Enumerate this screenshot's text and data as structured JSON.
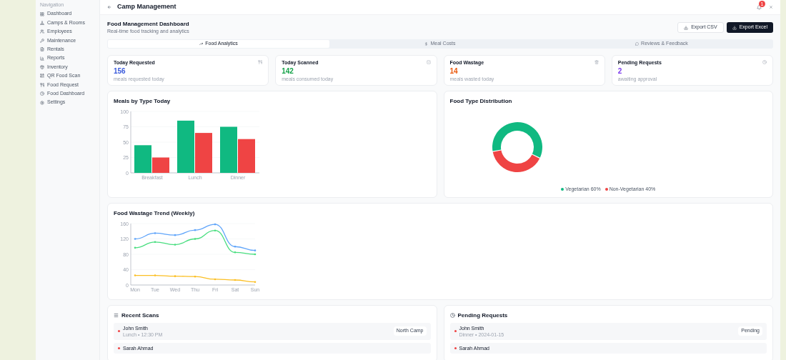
{
  "header": {
    "title": "Camp Management",
    "notification_count": "1"
  },
  "sidebar": {
    "heading": "Navigation",
    "items": [
      {
        "label": "Dashboard"
      },
      {
        "label": "Camps & Rooms"
      },
      {
        "label": "Employees"
      },
      {
        "label": "Maintenance"
      },
      {
        "label": "Rentals"
      },
      {
        "label": "Reports"
      },
      {
        "label": "Inventory"
      },
      {
        "label": "QR Food Scan"
      },
      {
        "label": "Food Request"
      },
      {
        "label": "Food Dashboard"
      },
      {
        "label": "Settings"
      }
    ]
  },
  "page": {
    "title": "Food Management Dashboard",
    "subtitle": "Real-time food tracking and analytics",
    "buttons": [
      {
        "label": "Export CSV",
        "kind": "outline"
      },
      {
        "label": "Export Excel",
        "kind": "solid"
      }
    ]
  },
  "tabs": [
    {
      "label": "Food Analytics",
      "selected": true
    },
    {
      "label": "Meal Costs",
      "selected": false
    },
    {
      "label": "Reviews & Feedback",
      "selected": false
    }
  ],
  "stats": [
    {
      "title": "Today Requested",
      "value": "156",
      "note": "meals requested today",
      "color": "#3b5bdb"
    },
    {
      "title": "Today Scanned",
      "value": "142",
      "note": "meals consumed today",
      "color": "#16a34a"
    },
    {
      "title": "Food Wastage",
      "value": "14",
      "note": "meals wasted today",
      "color": "#ea580c"
    },
    {
      "title": "Pending Requests",
      "value": "2",
      "note": "awaiting approval",
      "color": "#7c3aed"
    }
  ],
  "meals_chart": {
    "title": "Meals by Type Today",
    "chart_data": {
      "type": "bar",
      "categories": [
        "Breakfast",
        "Lunch",
        "Dinner"
      ],
      "ylim": [
        0,
        100
      ],
      "yticks": [
        0,
        25,
        50,
        75,
        100
      ],
      "series": [
        {
          "color": "#10b981",
          "values": [
            45,
            85,
            75
          ]
        },
        {
          "color": "#ef4444",
          "values": [
            25,
            65,
            55
          ]
        }
      ]
    }
  },
  "distribution_chart": {
    "title": "Food Type Distribution",
    "chart_data": {
      "type": "donut",
      "categories": [
        "Vegetarian 60%",
        "Non-Vegetarian 40%"
      ],
      "values": [
        60,
        40
      ]
    },
    "legend": [
      {
        "color": "#10b981"
      },
      {
        "color": "#ef4444"
      }
    ]
  },
  "wastage_chart": {
    "title": "Food Wastage Trend (Weekly)",
    "chart_data": {
      "type": "line",
      "categories": [
        "Mon",
        "Tue",
        "Wed",
        "Thu",
        "Fri",
        "Sat",
        "Sun"
      ],
      "ylim": [
        0,
        160
      ],
      "yticks": [
        0,
        40,
        80,
        120,
        160
      ],
      "series": [
        {
          "color": "#60a5fa",
          "values": [
            120,
            135,
            130,
            143,
            158,
            100,
            90
          ]
        },
        {
          "color": "#4ade80",
          "values": [
            97,
            112,
            105,
            120,
            142,
            85,
            80
          ]
        },
        {
          "color": "#fbbf24",
          "values": [
            25,
            25,
            23,
            22,
            15,
            13,
            8
          ]
        }
      ]
    }
  },
  "recent_scans": {
    "title": "Recent Scans",
    "items": [
      {
        "name": "John Smith",
        "detail": "Lunch • 12:30 PM",
        "tag": "North Camp"
      },
      {
        "name": "Sarah Ahmad"
      }
    ]
  },
  "pending_requests": {
    "title": "Pending Requests",
    "items": [
      {
        "name": "John Smith",
        "detail": "Dinner • 2024-01-15",
        "tag": "Pending"
      },
      {
        "name": "Sarah Ahmad"
      }
    ]
  }
}
